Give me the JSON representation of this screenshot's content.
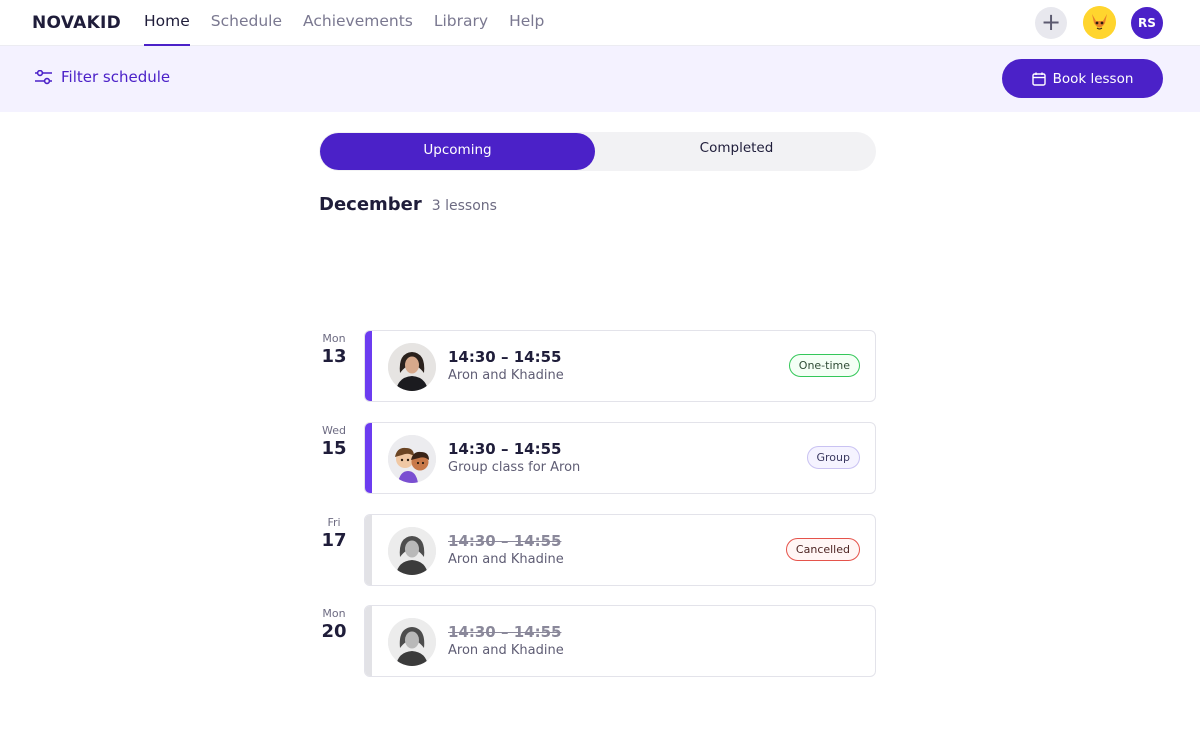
{
  "header": {
    "logo": "NOVAKID",
    "nav": [
      "Home",
      "Schedule",
      "Achievements",
      "Library",
      "Help"
    ],
    "active_nav": "Home",
    "user_initials": "RS"
  },
  "filterbar": {
    "filter_label": "Filter schedule",
    "book_label": "Book lesson"
  },
  "tabs": {
    "upcoming": "Upcoming",
    "completed": "Completed",
    "active": "Upcoming"
  },
  "month": {
    "name": "December",
    "count": "3 lessons"
  },
  "colors": {
    "brand": "#4b21c8",
    "lesson_bar": "#6c3cf0",
    "one_time": "#34c759",
    "cancelled": "#e5534b"
  },
  "lessons": [
    {
      "weekday": "Mon",
      "day": "13",
      "time": "14:30 – 14:55",
      "subtitle": "Aron and Khadine",
      "badge": "One-time",
      "status": "active"
    },
    {
      "weekday": "Wed",
      "day": "15",
      "time": "14:30 – 14:55",
      "subtitle": "Group class for Aron",
      "badge": "Group",
      "status": "active"
    },
    {
      "weekday": "Fri",
      "day": "17",
      "time": "14:30 – 14:55",
      "subtitle": "Aron and Khadine",
      "badge": "Cancelled",
      "status": "cancelled"
    },
    {
      "weekday": "Mon",
      "day": "20",
      "time": "14:30 – 14:55",
      "subtitle": "Aron and Khadine",
      "badge": "",
      "status": "cancelled"
    }
  ]
}
